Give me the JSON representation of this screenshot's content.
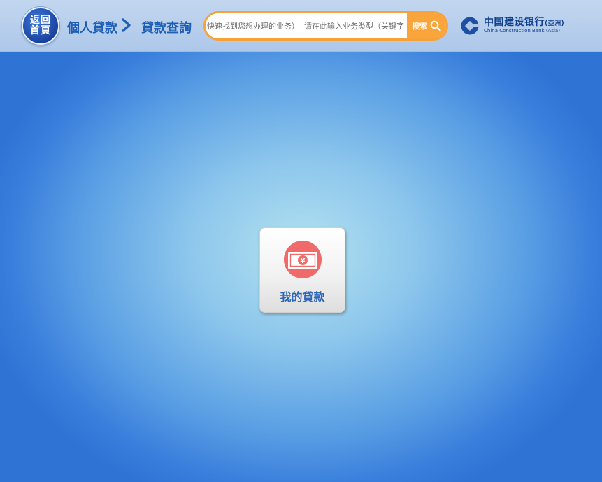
{
  "header": {
    "home_button_label": "返回首頁",
    "breadcrumb": [
      {
        "label": "個人貸款"
      },
      {
        "label": "貸款查詢"
      }
    ],
    "search": {
      "placeholder": "快速找到您想办理的业务）  请在此输入业务类型（关键字",
      "button_label": "搜索"
    },
    "logo": {
      "name_cn": "中国建设银行",
      "name_cn_suffix": "(亞洲)",
      "name_en": "China Construction Bank (Asia)"
    }
  },
  "main": {
    "cards": [
      {
        "label": "我的貸款",
        "icon": "yen-banknote-icon"
      }
    ]
  },
  "colors": {
    "accent_orange": "#f9a53b",
    "brand_blue": "#1e5fb5",
    "icon_red": "#f06a6a"
  }
}
